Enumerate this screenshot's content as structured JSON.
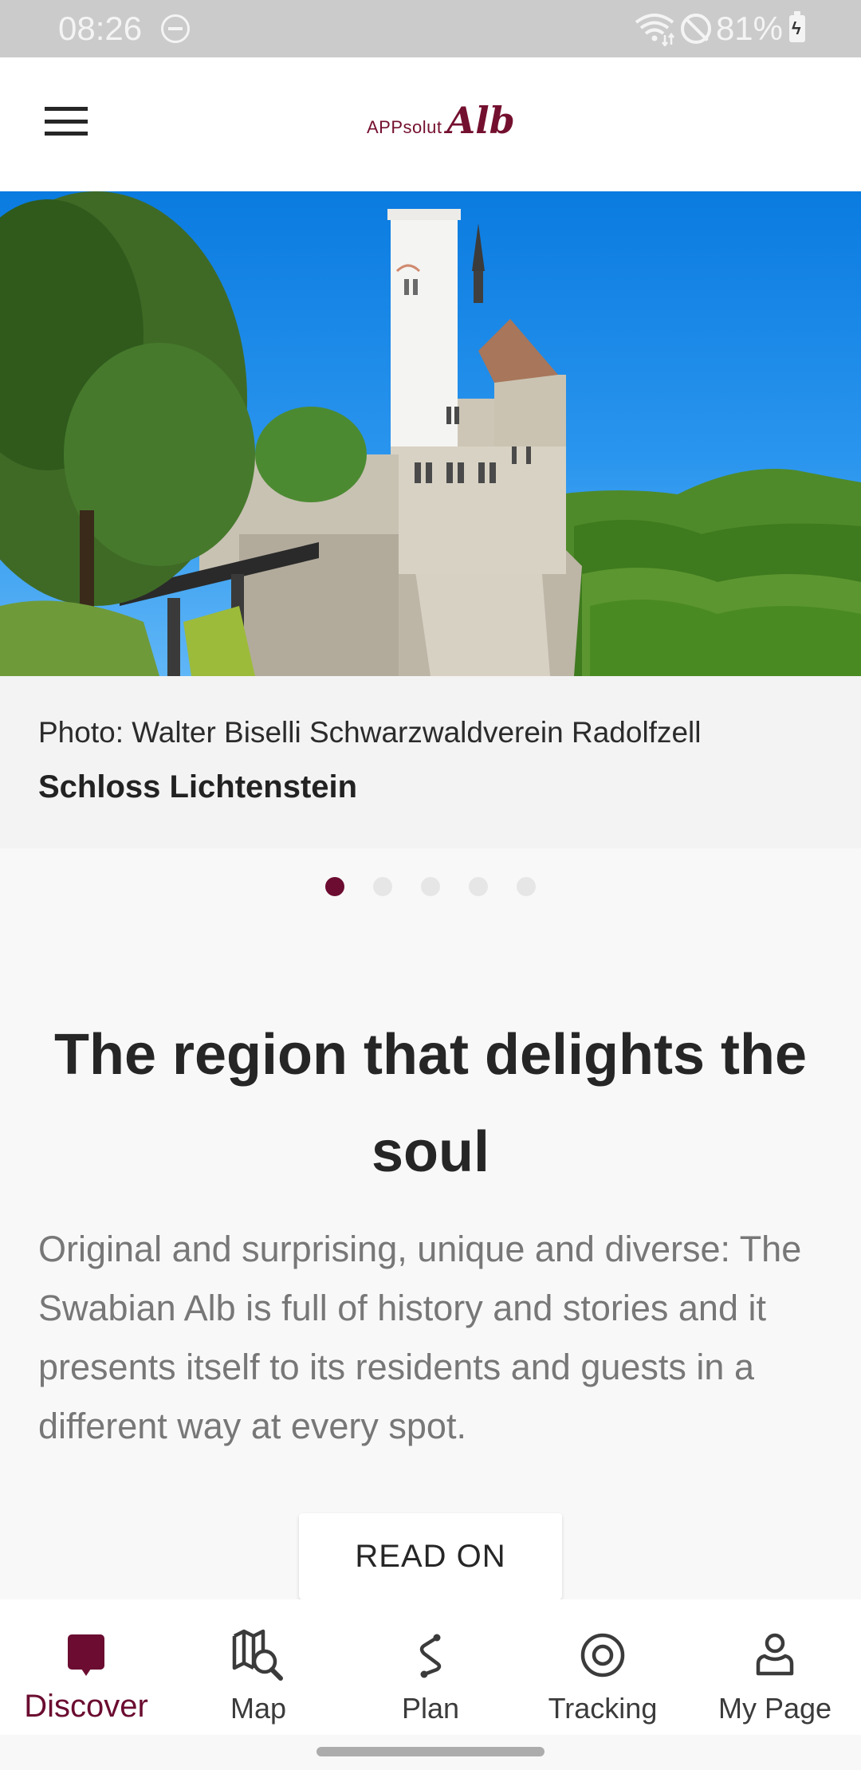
{
  "status_bar": {
    "time": "08:26",
    "battery_percent": "81%",
    "icons": [
      "do-not-disturb-icon",
      "wifi-icon",
      "blocked-icon",
      "battery-charging-icon"
    ]
  },
  "app_bar": {
    "menu_icon": "hamburger-menu-icon",
    "logo_prefix": "APPsolut",
    "logo_suffix": "Alb"
  },
  "hero": {
    "image_description": "Schloss Lichtenstein castle on a cliff with forest and blue sky",
    "photo_credit": "Photo: Walter Biselli Schwarzwaldverein Radolfzell",
    "title": "Schloss Lichtenstein"
  },
  "carousel": {
    "total": 5,
    "active_index": 0
  },
  "content": {
    "headline": "The region that delights the soul",
    "body": "Original and surprising, unique and diverse: The Swabian Alb is full of history and stories and it presents itself to its residents and guests in a different way at every spot.",
    "read_on_label": "READ ON"
  },
  "bottom_nav": {
    "items": [
      {
        "label": "Discover",
        "icon": "discover-icon",
        "active": true
      },
      {
        "label": "Map",
        "icon": "map-search-icon",
        "active": false
      },
      {
        "label": "Plan",
        "icon": "route-icon",
        "active": false
      },
      {
        "label": "Tracking",
        "icon": "tracking-target-icon",
        "active": false
      },
      {
        "label": "My Page",
        "icon": "user-icon",
        "active": false
      }
    ]
  },
  "colors": {
    "brand": "#6b0c30",
    "status_bar": "#cbcbcb",
    "text_dark": "#262626",
    "text_muted": "#777777",
    "inactive_dot": "#e6e6e6"
  }
}
